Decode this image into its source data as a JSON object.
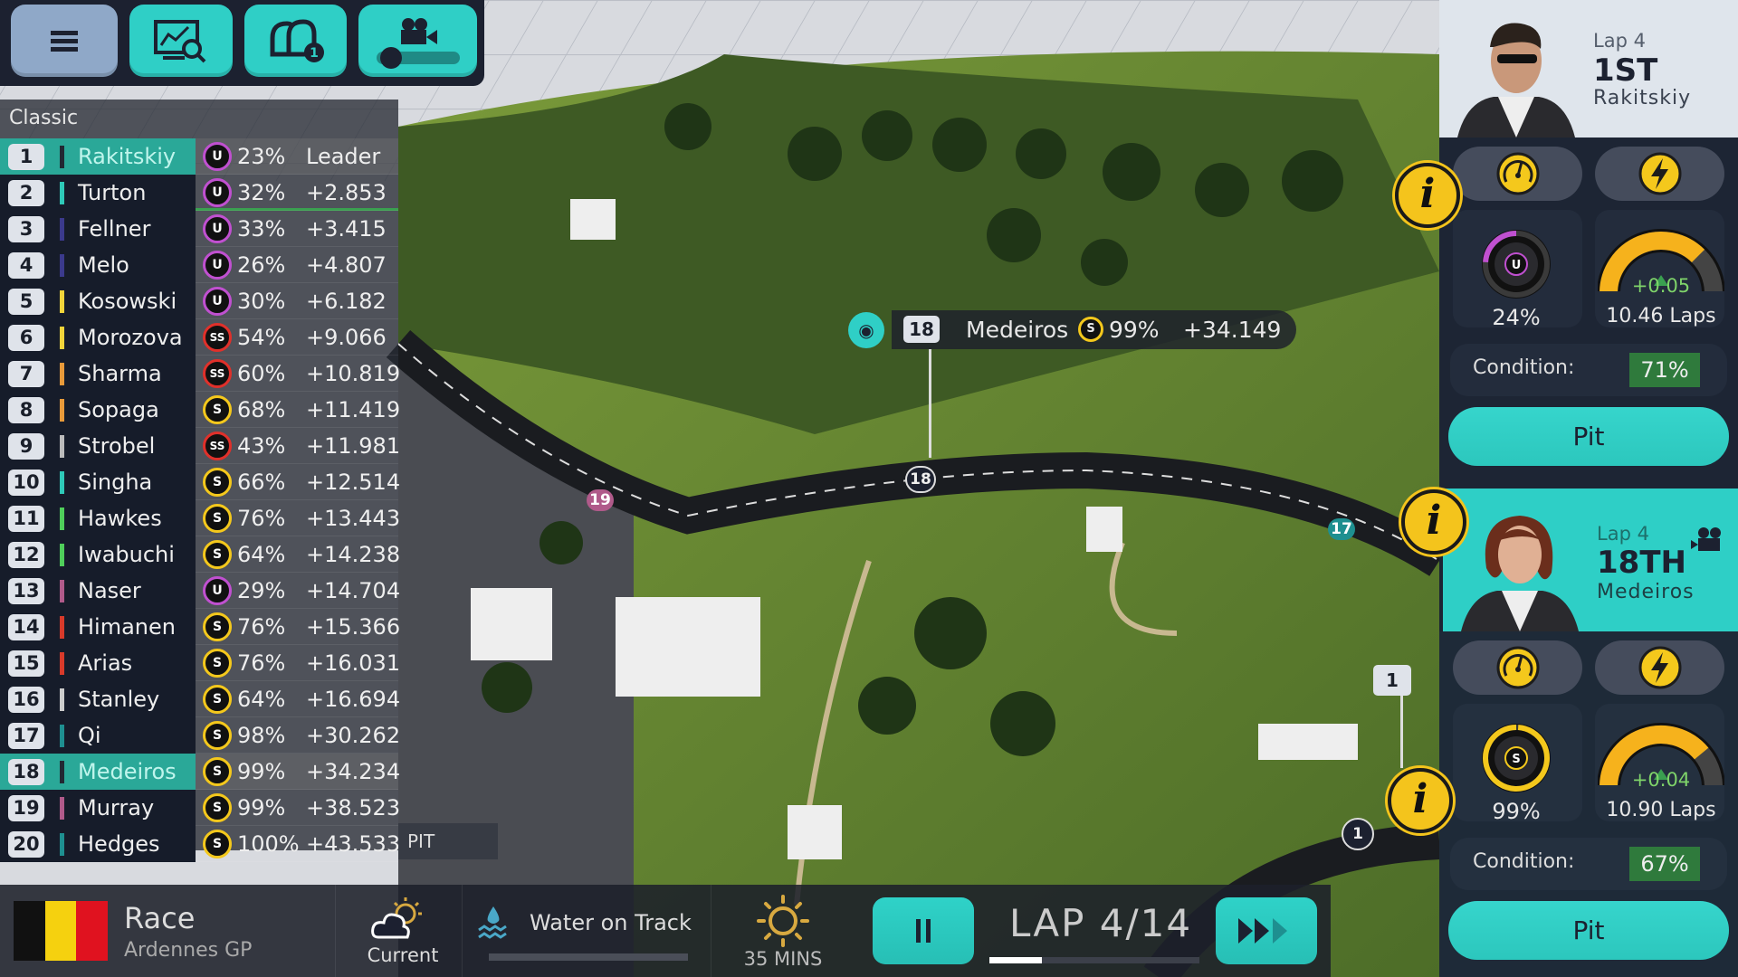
{
  "toolbar": {
    "buttons": [
      {
        "name": "menu",
        "icon": "hamburger-menu-icon"
      },
      {
        "name": "telemetry",
        "icon": "monitor-chart-search-icon"
      },
      {
        "name": "helmets",
        "icon": "helmets-icon",
        "badge": "1"
      },
      {
        "name": "camera",
        "icon": "camera-slider-icon"
      }
    ],
    "camera_slider_value": 0.1
  },
  "leaderboard": {
    "title": "Classic",
    "selected": [
      1,
      18
    ],
    "rows": [
      {
        "pos": "1",
        "name": "Rakitskiy",
        "team_color": "#222833",
        "tyre": "U",
        "pct": "23%",
        "gap": "Leader"
      },
      {
        "pos": "2",
        "name": "Turton",
        "team_color": "#2ec9b8",
        "tyre": "U",
        "pct": "32%",
        "gap": "+2.853"
      },
      {
        "pos": "3",
        "name": "Fellner",
        "team_color": "#3b3a8c",
        "tyre": "U",
        "pct": "33%",
        "gap": "+3.415"
      },
      {
        "pos": "4",
        "name": "Melo",
        "team_color": "#3b3a8c",
        "tyre": "U",
        "pct": "26%",
        "gap": "+4.807"
      },
      {
        "pos": "5",
        "name": "Kosowski",
        "team_color": "#f2d43a",
        "tyre": "U",
        "pct": "30%",
        "gap": "+6.182"
      },
      {
        "pos": "6",
        "name": "Morozova",
        "team_color": "#f2d43a",
        "tyre": "SS",
        "pct": "54%",
        "gap": "+9.066"
      },
      {
        "pos": "7",
        "name": "Sharma",
        "team_color": "#e89a3a",
        "tyre": "SS",
        "pct": "60%",
        "gap": "+10.819"
      },
      {
        "pos": "8",
        "name": "Sopaga",
        "team_color": "#e89a3a",
        "tyre": "S",
        "pct": "68%",
        "gap": "+11.419"
      },
      {
        "pos": "9",
        "name": "Strobel",
        "team_color": "#bbbbbb",
        "tyre": "SS",
        "pct": "43%",
        "gap": "+11.981"
      },
      {
        "pos": "10",
        "name": "Singha",
        "team_color": "#2ec9b8",
        "tyre": "S",
        "pct": "66%",
        "gap": "+12.514"
      },
      {
        "pos": "11",
        "name": "Hawkes",
        "team_color": "#4fce5a",
        "tyre": "S",
        "pct": "76%",
        "gap": "+13.443"
      },
      {
        "pos": "12",
        "name": "Iwabuchi",
        "team_color": "#4fce5a",
        "tyre": "S",
        "pct": "64%",
        "gap": "+14.238"
      },
      {
        "pos": "13",
        "name": "Naser",
        "team_color": "#b05a8a",
        "tyre": "U",
        "pct": "29%",
        "gap": "+14.704"
      },
      {
        "pos": "14",
        "name": "Himanen",
        "team_color": "#d83a2a",
        "tyre": "S",
        "pct": "76%",
        "gap": "+15.366"
      },
      {
        "pos": "15",
        "name": "Arias",
        "team_color": "#d83a2a",
        "tyre": "S",
        "pct": "76%",
        "gap": "+16.031"
      },
      {
        "pos": "16",
        "name": "Stanley",
        "team_color": "#cccccc",
        "tyre": "S",
        "pct": "64%",
        "gap": "+16.694"
      },
      {
        "pos": "17",
        "name": "Qi",
        "team_color": "#1e8f90",
        "tyre": "S",
        "pct": "98%",
        "gap": "+30.262"
      },
      {
        "pos": "18",
        "name": "Medeiros",
        "team_color": "#222833",
        "tyre": "S",
        "pct": "99%",
        "gap": "+34.234"
      },
      {
        "pos": "19",
        "name": "Murray",
        "team_color": "#b05a8a",
        "tyre": "S",
        "pct": "99%",
        "gap": "+38.523"
      },
      {
        "pos": "20",
        "name": "Hedges",
        "team_color": "#1e8f90",
        "tyre": "S",
        "pct": "100%",
        "gap": "+43.533"
      }
    ],
    "pit_label": "PIT"
  },
  "tyre_colors": {
    "U": "#c050d0",
    "SS": "#e0302a",
    "S": "#f4c81c"
  },
  "map": {
    "tooltip": {
      "pos": "18",
      "name": "Medeiros",
      "tyre": "S",
      "pct": "99%",
      "gap": "+34.149"
    },
    "markers": [
      "18",
      "19",
      "17",
      "1",
      "1"
    ]
  },
  "drivers": [
    {
      "lap": "Lap 4",
      "place": "1ST",
      "name": "Rakitskiy",
      "tyre": "U",
      "tyre_wear": "24%",
      "tyre_wear_fraction": 0.24,
      "fuel_delta": "+0.05",
      "fuel_laps": "10.46 Laps",
      "fuel_fraction": 0.75,
      "condition_label": "Condition:",
      "condition": "71%",
      "pit": "Pit"
    },
    {
      "lap": "Lap 4",
      "place": "18TH",
      "name": "Medeiros",
      "tyre": "S",
      "tyre_wear": "99%",
      "tyre_wear_fraction": 0.99,
      "fuel_delta": "+0.04",
      "fuel_laps": "10.90 Laps",
      "fuel_fraction": 0.78,
      "condition_label": "Condition:",
      "condition": "67%",
      "pit": "Pit",
      "camera_followed": true
    }
  ],
  "bottom": {
    "session": "Race",
    "event": "Ardennes GP",
    "flag_colors": [
      "#111111",
      "#f5d10f",
      "#e0121f"
    ],
    "weather_label": "Current",
    "track_condition": "Water on Track",
    "forecast": "35 MINS",
    "lap": "LAP 4/14",
    "lap_progress": 0.25
  },
  "accent": "#2fcfc6"
}
